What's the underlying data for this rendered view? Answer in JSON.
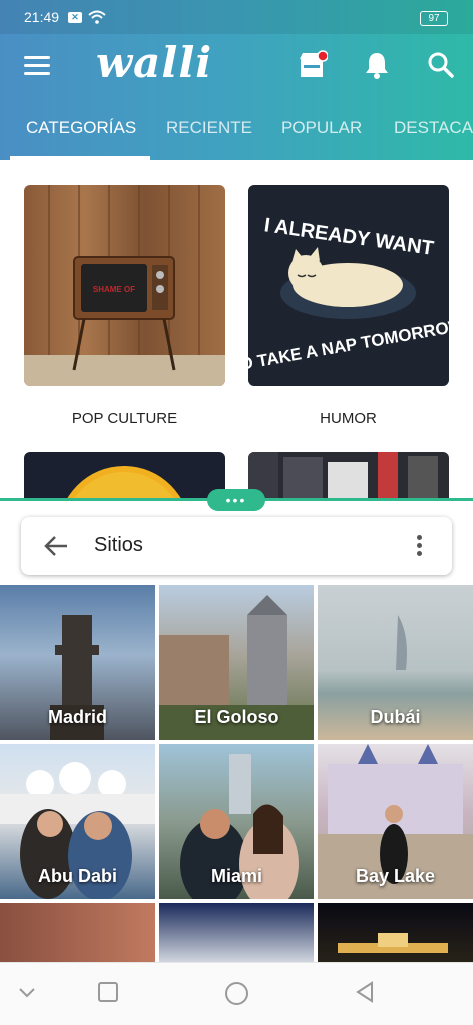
{
  "status": {
    "time": "21:49",
    "battery": "97"
  },
  "appbar": {
    "logo": "walli"
  },
  "tabs": [
    "CATEGORÍAS",
    "RECIENTE",
    "POPULAR",
    "DESTACA"
  ],
  "categories": [
    {
      "label": "POP CULTURE",
      "tv_text": "SHAME OF"
    },
    {
      "label": "HUMOR",
      "art_text": [
        "I ALREADY WANT",
        "TO TAKE A NAP TOMORROW"
      ]
    }
  ],
  "sheet": {
    "title": "Sitios"
  },
  "places": [
    "Madrid",
    "El Goloso",
    "Dubái",
    "Abu Dabi",
    "Miami",
    "Bay Lake"
  ],
  "colors": {
    "accent": "#2fb98d",
    "header_start": "#4a8fc4",
    "header_end": "#2fb9a8",
    "notif_dot": "#e8222c"
  }
}
